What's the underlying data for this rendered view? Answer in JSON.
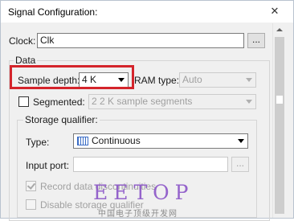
{
  "window": {
    "title": "Signal Configuration:",
    "close_glyph": "✕"
  },
  "clock": {
    "label": "Clock:",
    "value": "Clk",
    "browse_label": "..."
  },
  "data_group": {
    "title": "Data",
    "sample_depth": {
      "label": "Sample depth:",
      "value": "4 K"
    },
    "ram_type": {
      "label": "RAM type:",
      "value": "Auto"
    },
    "segmented": {
      "label": "Segmented:",
      "checked": false,
      "value": "2  2 K sample segments"
    },
    "storage_qualifier": {
      "title": "Storage qualifier:",
      "type": {
        "label": "Type:",
        "value": "Continuous",
        "icon": "continuous-icon"
      },
      "input_port": {
        "label": "Input port:",
        "value": "",
        "browse_label": "..."
      },
      "record_data_discontinuities": {
        "label": "Record data discontinuities",
        "checked": true
      },
      "disable_storage_qualifier": {
        "label": "Disable storage qualifier",
        "checked": false
      }
    }
  },
  "watermark": {
    "main": "EETOP",
    "sub": "中国电子顶级开发网"
  },
  "colors": {
    "highlight": "#d4242b",
    "watermark": "#8b54c8"
  }
}
